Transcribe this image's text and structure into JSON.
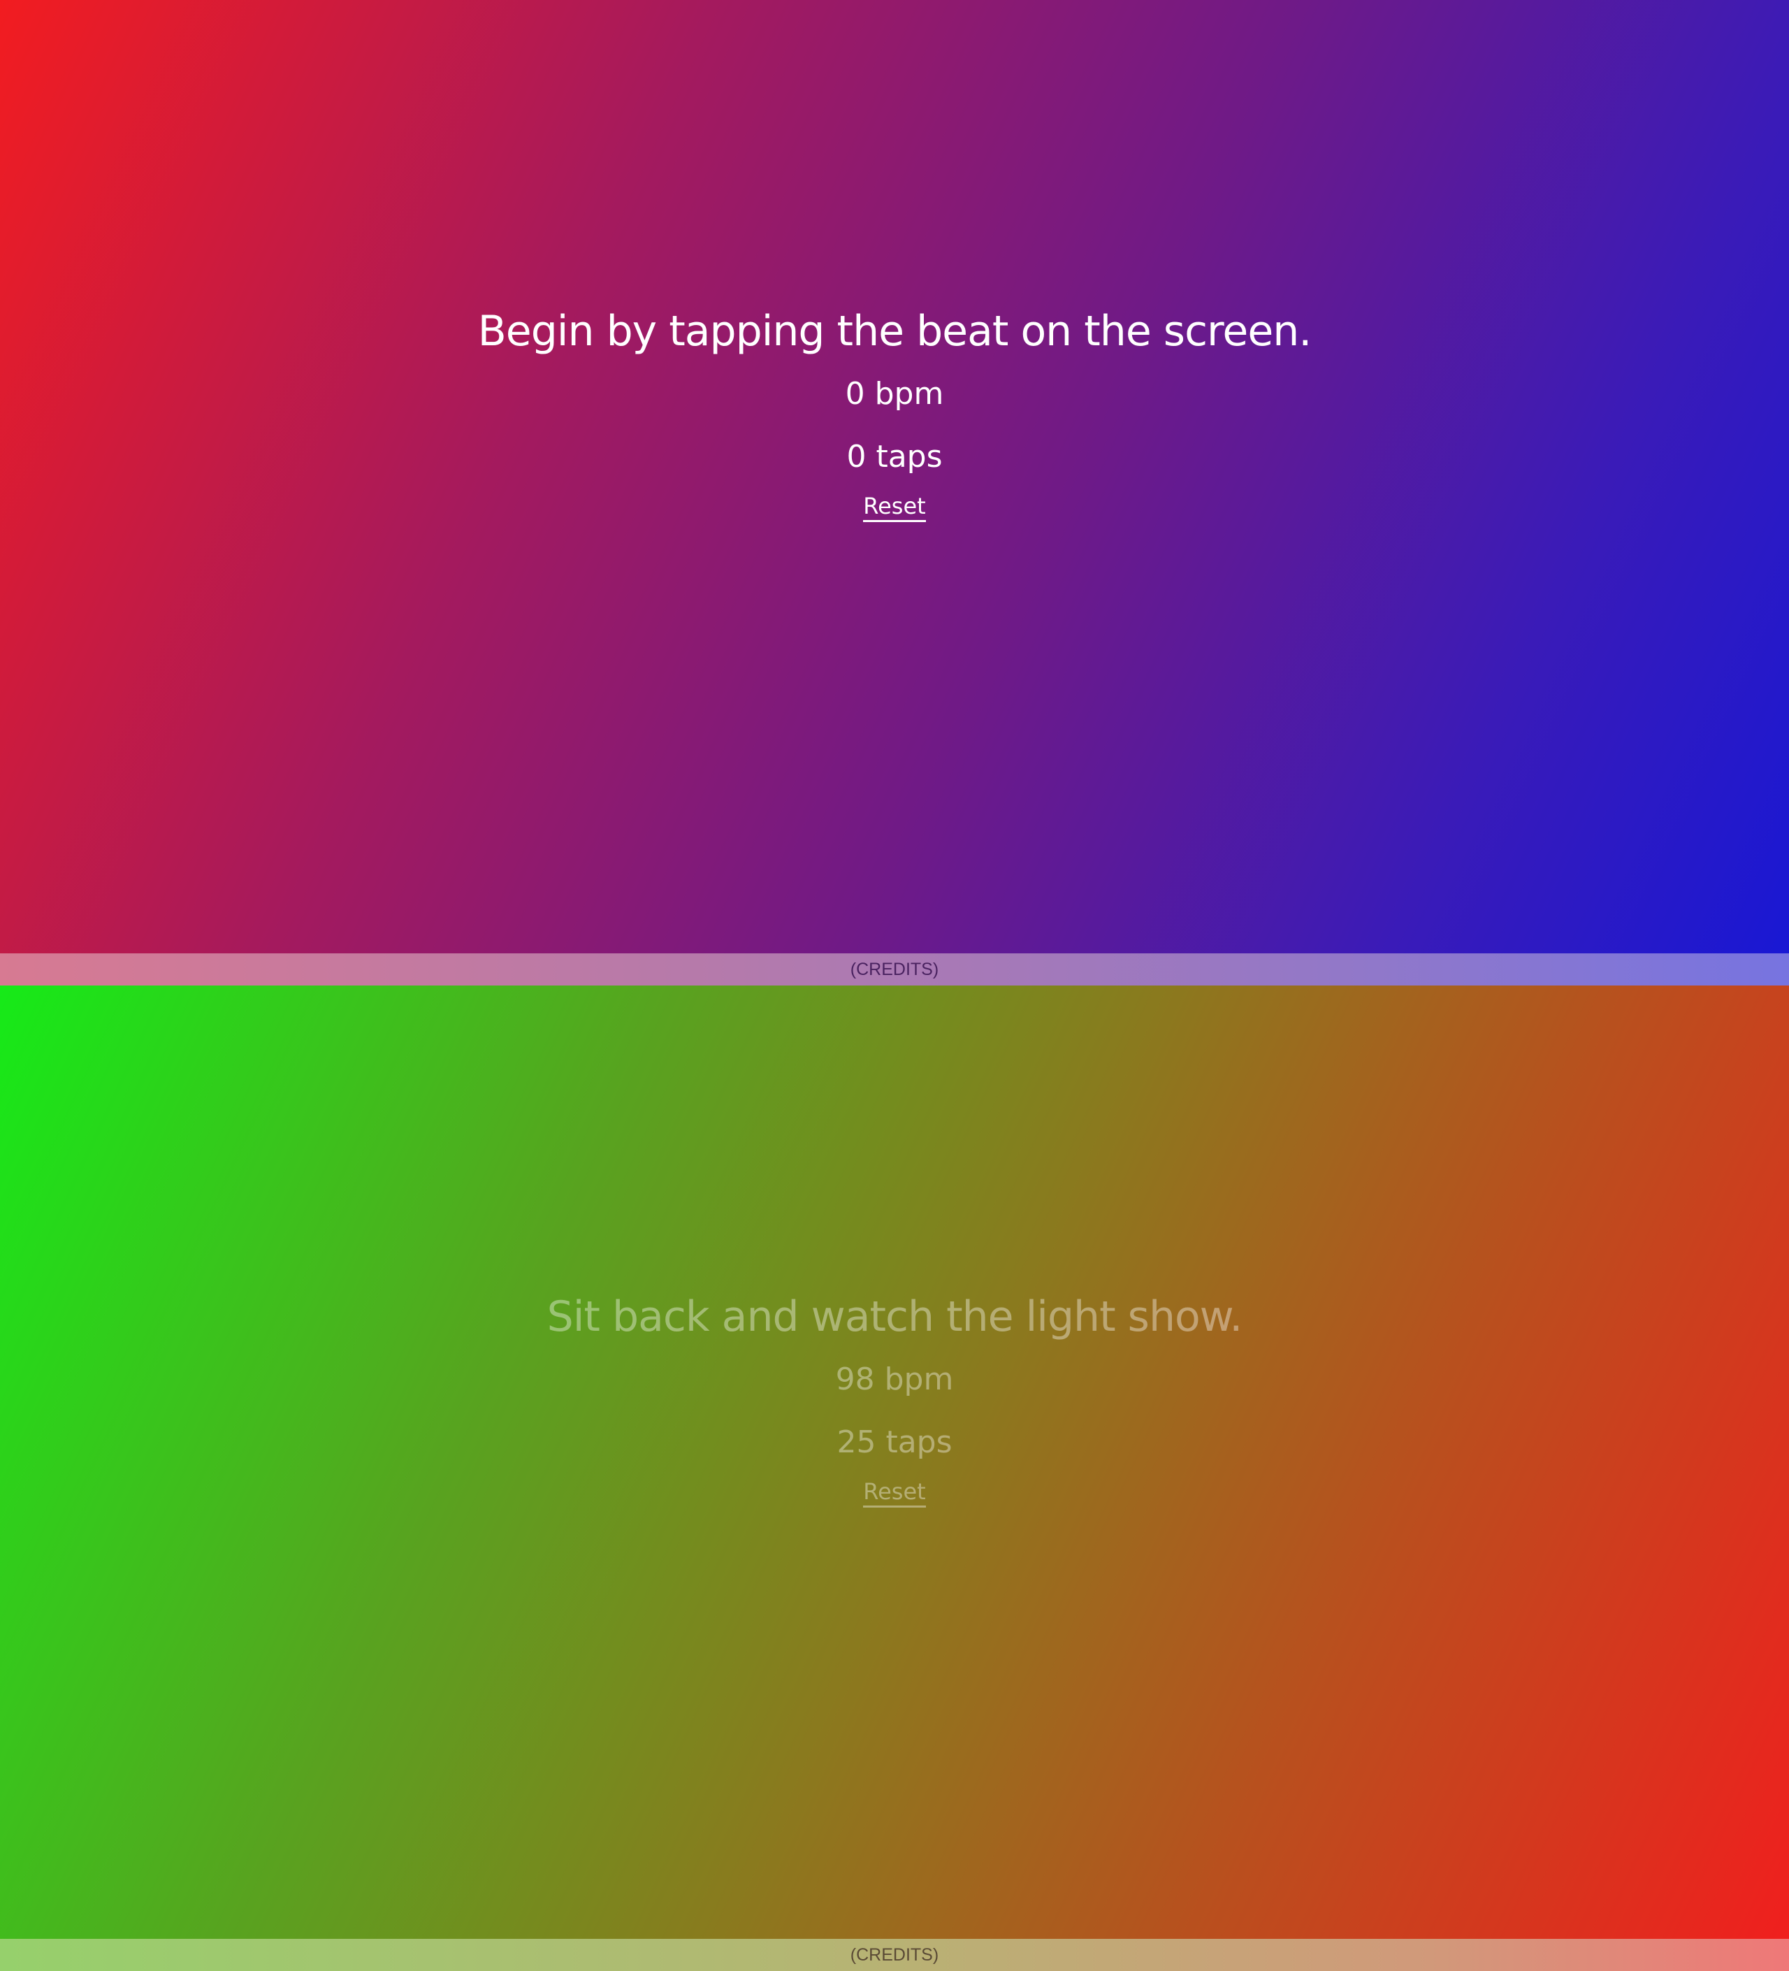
{
  "panels": [
    {
      "instruction": "Begin by tapping the beat on the screen.",
      "bpm_text": "0 bpm",
      "taps_text": "0 taps",
      "reset_label": "Reset",
      "credits_label": "(CREDITS)",
      "colors": {
        "gradient_start": "#f21c20",
        "gradient_end": "#1918d4"
      }
    },
    {
      "instruction": "Sit back and watch the light show.",
      "bpm_text": "98 bpm",
      "taps_text": "25 taps",
      "reset_label": "Reset",
      "credits_label": "(CREDITS)",
      "colors": {
        "gradient_start": "#16ea18",
        "gradient_end": "#f01f1e"
      }
    }
  ]
}
